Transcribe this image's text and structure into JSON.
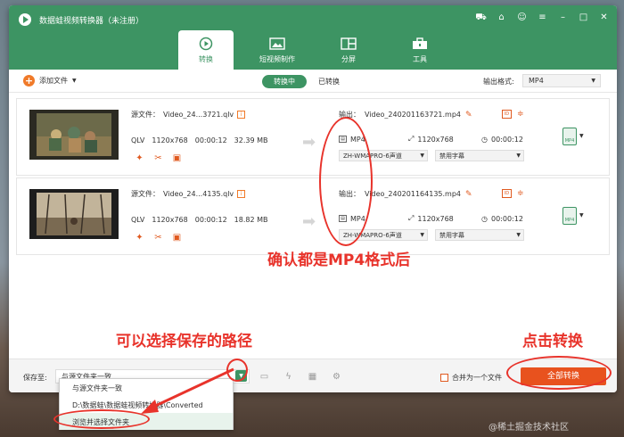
{
  "app": {
    "title": "数据蛙视频转换器（未注册）",
    "accent": "#3d9463",
    "orange": "#e8521e"
  },
  "titlebar_icons": [
    "cart-icon",
    "gift-icon",
    "account-icon",
    "menu-icon",
    "minimize-icon",
    "maximize-icon",
    "close-icon"
  ],
  "tabs": [
    {
      "label": "转换",
      "icon": "convert-icon",
      "active": true
    },
    {
      "label": "短视频制作",
      "icon": "image-icon",
      "active": false
    },
    {
      "label": "分屏",
      "icon": "split-screen-icon",
      "active": false
    },
    {
      "label": "工具",
      "icon": "toolbox-icon",
      "active": false
    }
  ],
  "toolbar": {
    "add_file": "添加文件",
    "seg_converting": "转换中",
    "seg_converted": "已转换",
    "output_format_label": "输出格式:",
    "output_format_value": "MP4"
  },
  "files": [
    {
      "source_label": "源文件：",
      "source_name": "Video_24...3721.qlv",
      "format": "QLV",
      "resolution": "1120x768",
      "duration": "00:00:12",
      "size": "32.39 MB",
      "output_label": "输出：",
      "output_name": "Video_240201163721.mp4",
      "out_format": "MP4",
      "out_resolution": "1120x768",
      "out_duration": "00:00:12",
      "audio": "ZH-WMAPRO-6声道",
      "subtitle": "禁用字幕",
      "format_button": "MP4"
    },
    {
      "source_label": "源文件：",
      "source_name": "Video_24...4135.qlv",
      "format": "QLV",
      "resolution": "1120x768",
      "duration": "00:00:12",
      "size": "18.82 MB",
      "output_label": "输出：",
      "output_name": "Video_240201164135.mp4",
      "out_format": "MP4",
      "out_resolution": "1120x768",
      "out_duration": "00:00:12",
      "audio": "ZH-WMAPRO-6声道",
      "subtitle": "禁用字幕",
      "format_button": "MP4"
    }
  ],
  "bottom": {
    "save_to_label": "保存至:",
    "save_to_value": "与源文件夹一致",
    "merge_label": "合并为一个文件",
    "convert_all": "全部转换"
  },
  "save_menu": [
    "与源文件夹一致",
    "D:\\数据蛙\\数据蛙视频转换器\\Converted",
    "浏览并选择文件夹"
  ],
  "annotations": {
    "confirm_format": "确认都是MP4格式后",
    "choose_path": "可以选择保存的路径",
    "click_convert": "点击转换"
  },
  "watermark": "@稀土掘金技术社区"
}
